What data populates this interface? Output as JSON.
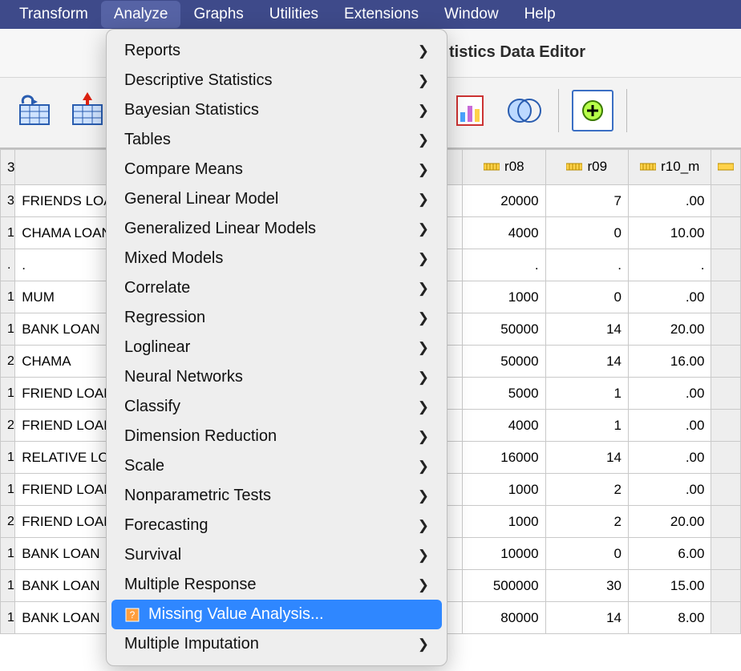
{
  "menubar": {
    "items": [
      {
        "label": "Transform",
        "active": false
      },
      {
        "label": "Analyze",
        "active": true
      },
      {
        "label": "Graphs",
        "active": false
      },
      {
        "label": "Utilities",
        "active": false
      },
      {
        "label": "Extensions",
        "active": false
      },
      {
        "label": "Window",
        "active": false
      },
      {
        "label": "Help",
        "active": false
      }
    ]
  },
  "window_title_fragment": "tistics Data Editor",
  "dropdown": {
    "items": [
      {
        "label": "Reports",
        "submenu": true,
        "highlight": false
      },
      {
        "label": "Descriptive Statistics",
        "submenu": true,
        "highlight": false
      },
      {
        "label": "Bayesian Statistics",
        "submenu": true,
        "highlight": false
      },
      {
        "label": "Tables",
        "submenu": true,
        "highlight": false
      },
      {
        "label": "Compare Means",
        "submenu": true,
        "highlight": false
      },
      {
        "label": "General Linear Model",
        "submenu": true,
        "highlight": false
      },
      {
        "label": "Generalized Linear Models",
        "submenu": true,
        "highlight": false
      },
      {
        "label": "Mixed Models",
        "submenu": true,
        "highlight": false
      },
      {
        "label": "Correlate",
        "submenu": true,
        "highlight": false
      },
      {
        "label": "Regression",
        "submenu": true,
        "highlight": false
      },
      {
        "label": "Loglinear",
        "submenu": true,
        "highlight": false
      },
      {
        "label": "Neural Networks",
        "submenu": true,
        "highlight": false
      },
      {
        "label": "Classify",
        "submenu": true,
        "highlight": false
      },
      {
        "label": "Dimension Reduction",
        "submenu": true,
        "highlight": false
      },
      {
        "label": "Scale",
        "submenu": true,
        "highlight": false
      },
      {
        "label": "Nonparametric Tests",
        "submenu": true,
        "highlight": false
      },
      {
        "label": "Forecasting",
        "submenu": true,
        "highlight": false
      },
      {
        "label": "Survival",
        "submenu": true,
        "highlight": false
      },
      {
        "label": "Multiple Response",
        "submenu": true,
        "highlight": false
      },
      {
        "label": "Missing Value Analysis...",
        "submenu": false,
        "highlight": true,
        "icon": "mva-icon"
      },
      {
        "label": "Multiple Imputation",
        "submenu": true,
        "highlight": false
      }
    ]
  },
  "columns": {
    "c1": "r08",
    "c2": "r09",
    "c3": "r10_m"
  },
  "rows": [
    {
      "n": "3",
      "name": "FRIENDS LOAN",
      "r08": "20000",
      "r09": "7",
      "r10": ".00"
    },
    {
      "n": "1",
      "name": "CHAMA LOAN",
      "r08": "4000",
      "r09": "0",
      "r10": "10.00"
    },
    {
      "n": ".",
      "name": ".",
      "r08": ".",
      "r09": ".",
      "r10": "."
    },
    {
      "n": "1",
      "name": "MUM",
      "r08": "1000",
      "r09": "0",
      "r10": ".00"
    },
    {
      "n": "1",
      "name": "BANK LOAN",
      "r08": "50000",
      "r09": "14",
      "r10": "20.00"
    },
    {
      "n": "2",
      "name": "CHAMA",
      "r08": "50000",
      "r09": "14",
      "r10": "16.00"
    },
    {
      "n": "1",
      "name": "FRIEND LOAN",
      "r08": "5000",
      "r09": "1",
      "r10": ".00"
    },
    {
      "n": "2",
      "name": "FRIEND LOAN",
      "r08": "4000",
      "r09": "1",
      "r10": ".00"
    },
    {
      "n": "1",
      "name": "RELATIVE LOAN",
      "r08": "16000",
      "r09": "14",
      "r10": ".00"
    },
    {
      "n": "1",
      "name": "FRIEND LOAN",
      "r08": "1000",
      "r09": "2",
      "r10": ".00"
    },
    {
      "n": "2",
      "name": "FRIEND LOAN",
      "r08": "1000",
      "r09": "2",
      "r10": "20.00"
    },
    {
      "n": "1",
      "name": "BANK LOAN",
      "r08": "10000",
      "r09": "0",
      "r10": "6.00"
    },
    {
      "n": "1",
      "name": "BANK LOAN",
      "r08": "500000",
      "r09": "30",
      "r10": "15.00"
    },
    {
      "n": "1",
      "name": "BANK LOAN",
      "r08": "80000",
      "r09": "14",
      "r10": "8.00"
    }
  ]
}
